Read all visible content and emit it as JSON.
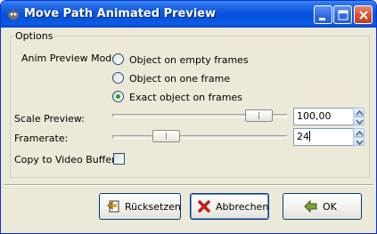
{
  "window": {
    "title": "Move Path Animated Preview"
  },
  "options": {
    "group_label": "Options",
    "anim_preview_mode_label": "Anim Preview Mode:",
    "anim_preview_modes": [
      {
        "label": "Object on empty frames",
        "selected": false
      },
      {
        "label": "Object on one frame",
        "selected": false
      },
      {
        "label": "Exact object on frames",
        "selected": true
      }
    ],
    "scale_preview": {
      "label": "Scale Preview:",
      "value": "100,00",
      "slider_fraction": 0.9
    },
    "framerate": {
      "label": "Framerate:",
      "value": "24",
      "slider_fraction": 0.27
    },
    "copy_to_video_buffer": {
      "label": "Copy to Video Buffer:",
      "checked": false
    }
  },
  "buttons": {
    "reset_label": "Rücksetzen",
    "cancel_label": "Abbrechen",
    "ok_label": "OK"
  },
  "colors": {
    "titlebar": "#0a55df",
    "radio_selected": "#21a121",
    "dialog_bg": "#ece9d8"
  }
}
